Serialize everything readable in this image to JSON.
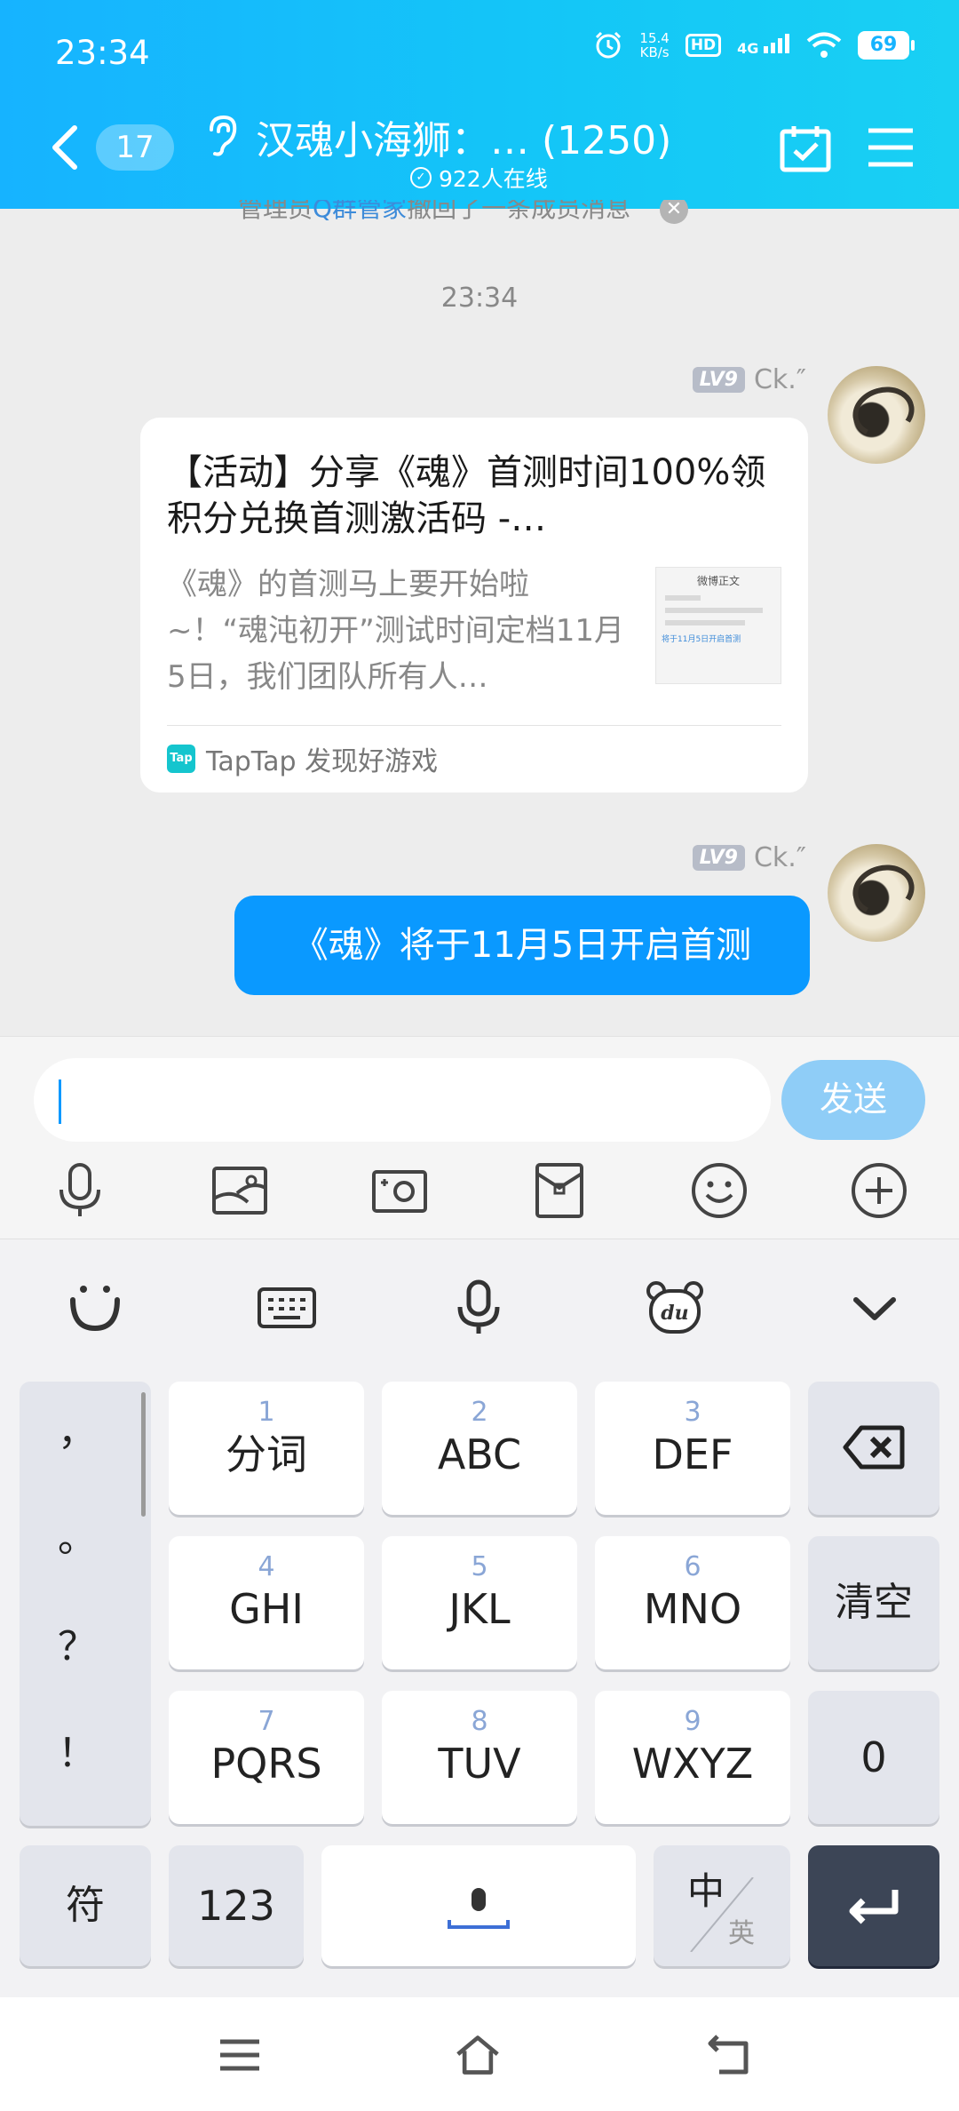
{
  "status_bar": {
    "time": "23:34",
    "net_speed_value": "15.4",
    "net_speed_unit": "KB/s",
    "hd": "HD",
    "network": "4G",
    "battery": "69",
    "icons": [
      "alarm-icon",
      "hd-icon",
      "signal-icon",
      "wifi-icon",
      "battery-icon"
    ]
  },
  "header": {
    "back_icon": "chevron-left-icon",
    "unread_count": "17",
    "title": "汉魂小海狮：… (1250)",
    "online_status": "922人在线",
    "actions": [
      "calendar-check-icon",
      "menu-icon"
    ]
  },
  "chat": {
    "system_notice": {
      "prefix": "管理员",
      "actor": "Q群管家",
      "suffix": "撤回了一条成员消息"
    },
    "timestamp": "23:34",
    "messages": [
      {
        "sender": "Ck.″",
        "level": "LV9",
        "type": "share_card",
        "title": "【活动】分享《魂》首测时间100%领积分兑换首测激活码 -…",
        "description": "《魂》的首测马上要开始啦~！“魂沌初开”测试时间定档11月5日，我们团队所有人…",
        "thumbnail_title": "微博正文",
        "thumbnail_link": "将于11月5日开启首测",
        "source": "TapTap 发现好游戏",
        "source_logo": "Tap"
      },
      {
        "sender": "Ck.″",
        "level": "LV9",
        "type": "text",
        "text": "《魂》将于11月5日开启首测"
      }
    ]
  },
  "input_bar": {
    "value": "",
    "send_label": "发送",
    "tools": [
      "microphone-icon",
      "image-icon",
      "camera-icon",
      "red-packet-icon",
      "emoji-icon",
      "plus-icon"
    ]
  },
  "keyboard": {
    "toolbar": [
      "smile-logo-icon",
      "keyboard-icon",
      "voice-icon",
      "du-bear-icon",
      "collapse-icon"
    ],
    "punctuation": [
      "，",
      "。",
      "？",
      "！"
    ],
    "keys": [
      {
        "num": "1",
        "label": "分词"
      },
      {
        "num": "2",
        "label": "ABC"
      },
      {
        "num": "3",
        "label": "DEF"
      },
      {
        "num": "4",
        "label": "GHI"
      },
      {
        "num": "5",
        "label": "JKL"
      },
      {
        "num": "6",
        "label": "MNO"
      },
      {
        "num": "7",
        "label": "PQRS"
      },
      {
        "num": "8",
        "label": "TUV"
      },
      {
        "num": "9",
        "label": "WXYZ"
      }
    ],
    "clear_label": "清空",
    "zero_label": "0",
    "symbol_label": "符",
    "numeric_label": "123",
    "lang_main": "中",
    "lang_alt": "英"
  },
  "nav_bar": [
    "menu-lines-icon",
    "home-icon",
    "back-icon"
  ]
}
